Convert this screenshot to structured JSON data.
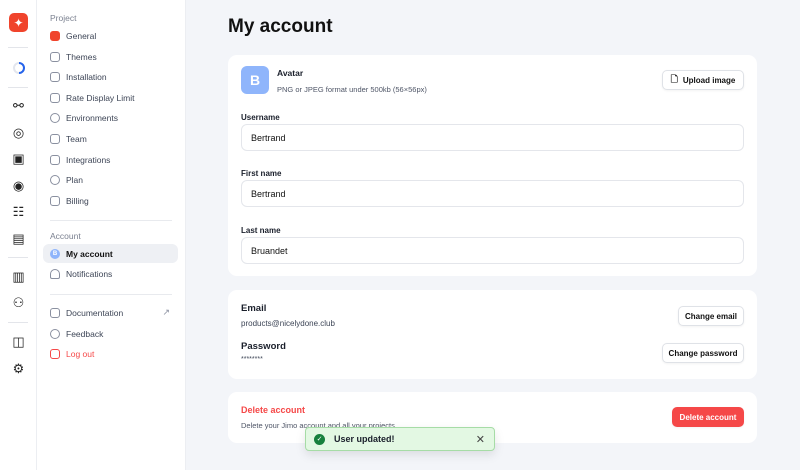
{
  "sidebar": {
    "project_label": "Project",
    "project_items": [
      {
        "label": "General",
        "icon": "sparkle-icon"
      },
      {
        "label": "Themes",
        "icon": "brush-icon"
      },
      {
        "label": "Installation",
        "icon": "install-icon"
      },
      {
        "label": "Rate Display Limit",
        "icon": "rate-icon"
      },
      {
        "label": "Environments",
        "icon": "globe-icon"
      },
      {
        "label": "Team",
        "icon": "team-icon"
      },
      {
        "label": "Integrations",
        "icon": "integrations-icon"
      },
      {
        "label": "Plan",
        "icon": "dollar-icon"
      },
      {
        "label": "Billing",
        "icon": "card-icon"
      }
    ],
    "account_label": "Account",
    "account_items": [
      {
        "label": "My account",
        "avatar": "B"
      },
      {
        "label": "Notifications"
      }
    ],
    "other_items": [
      {
        "label": "Documentation"
      },
      {
        "label": "Feedback"
      },
      {
        "label": "Log out"
      }
    ]
  },
  "page": {
    "title": "My account"
  },
  "profile": {
    "avatar_letter": "B",
    "avatar_title": "Avatar",
    "avatar_hint": "PNG or JPEG format under 500kb (56×56px)",
    "upload_label": "Upload image",
    "username_label": "Username",
    "username": "Bertrand",
    "first_name_label": "First name",
    "first_name": "Bertrand",
    "last_name_label": "Last name",
    "last_name": "Bruandet"
  },
  "credentials": {
    "email_label": "Email",
    "email": "products@nicelydone.club",
    "change_email": "Change email",
    "password_label": "Password",
    "password": "********",
    "change_password": "Change password"
  },
  "danger": {
    "title": "Delete account",
    "description": "Delete your Jimo account and all your projects.",
    "button": "Delete account"
  },
  "toast": {
    "message": "User updated!"
  },
  "colors": {
    "accent": "#f0442c",
    "danger": "#f54848",
    "avatar": "#8fb5fb",
    "toast_bg": "#e3f8e3"
  }
}
